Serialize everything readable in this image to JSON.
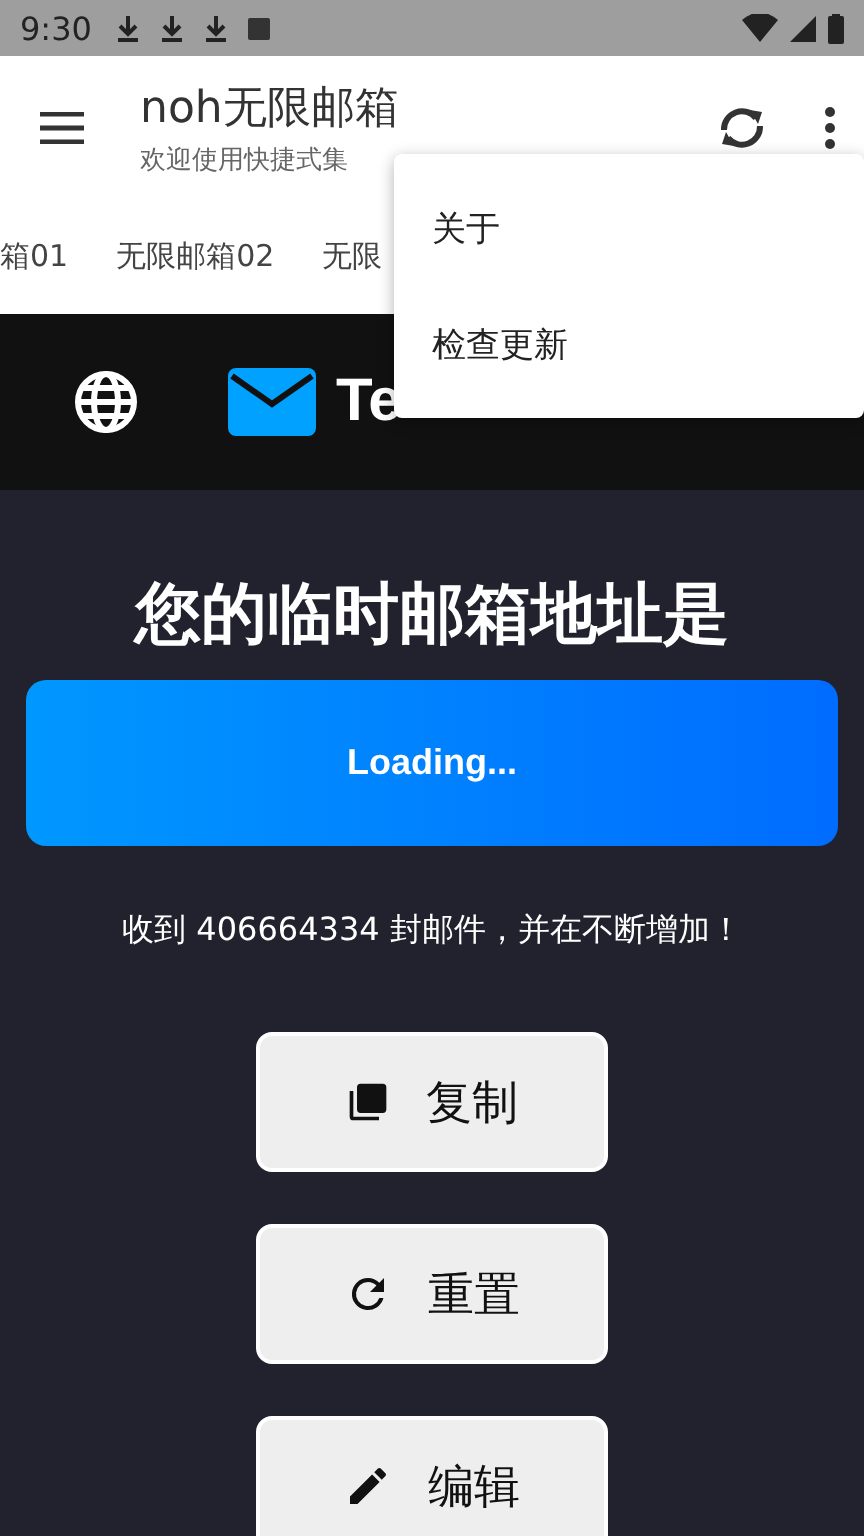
{
  "status_bar": {
    "time": "9:30"
  },
  "app_bar": {
    "title": "noh无限邮箱",
    "subtitle": "欢迎使用快捷式集"
  },
  "tabs": [
    {
      "label": "箱01",
      "selected": false
    },
    {
      "label": "无限邮箱02",
      "selected": false
    },
    {
      "label": "无限",
      "selected": false
    }
  ],
  "site_header": {
    "logo_text": "Te"
  },
  "content": {
    "heading": "您的临时邮箱地址是",
    "address": "Loading...",
    "stats": "收到 406664334 封邮件，并在不断增加！",
    "buttons": [
      {
        "kind": "copy",
        "label": "复制"
      },
      {
        "kind": "reset",
        "label": "重置"
      },
      {
        "kind": "edit",
        "label": "编辑"
      }
    ]
  },
  "menu": {
    "items": [
      "关于",
      "检查更新"
    ]
  }
}
